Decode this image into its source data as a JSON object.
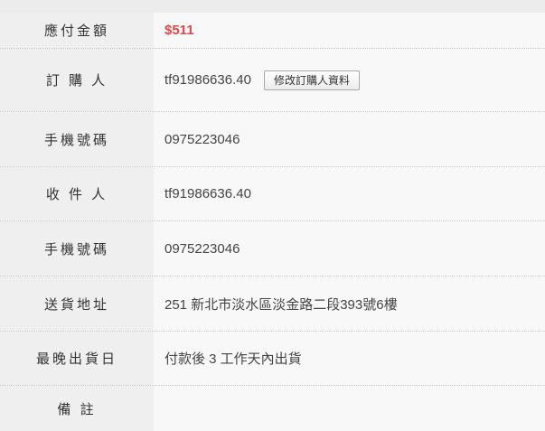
{
  "order": {
    "amount_label": "應付金額",
    "amount_value": "$511",
    "buyer_label": "訂 購 人",
    "buyer_value": "tf91986636.40",
    "edit_buyer_button": "修改訂購人資料",
    "buyer_phone_label": "手機號碼",
    "buyer_phone_value": "0975223046",
    "recipient_label": "收 件 人",
    "recipient_value": "tf91986636.40",
    "recipient_phone_label": "手機號碼",
    "recipient_phone_value": "0975223046",
    "address_label": "送貨地址",
    "address_value": "251 新北市淡水區淡金路二段393號6樓",
    "delivery_date_label": "最晚出貨日",
    "delivery_date_value": "付款後 3 工作天內出貨",
    "note_label": "備 註",
    "note_value": ""
  },
  "colors": {
    "amount": "#e04848",
    "label_bg": "#efefef",
    "value_bg": "#f8f8f8"
  }
}
